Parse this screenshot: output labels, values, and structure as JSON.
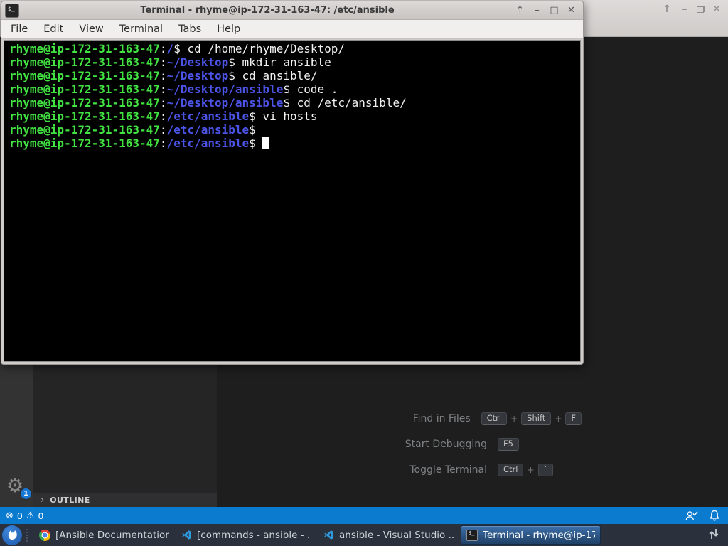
{
  "terminal_window": {
    "title": "Terminal - rhyme@ip-172-31-163-47: /etc/ansible",
    "menu": [
      "File",
      "Edit",
      "View",
      "Terminal",
      "Tabs",
      "Help"
    ],
    "user": "rhyme@ip-172-31-163-47",
    "prompt_separator": ":",
    "prompt_symbol": "$",
    "lines": [
      {
        "path": "/",
        "command": "cd /home/rhyme/Desktop/"
      },
      {
        "path": "~/Desktop",
        "command": "mkdir ansible"
      },
      {
        "path": "~/Desktop",
        "command": "cd ansible/"
      },
      {
        "path": "~/Desktop/ansible",
        "command": "code ."
      },
      {
        "path": "~/Desktop/ansible",
        "command": "cd /etc/ansible/"
      },
      {
        "path": "/etc/ansible",
        "command": "vi hosts"
      },
      {
        "path": "/etc/ansible",
        "command": ""
      },
      {
        "path": "/etc/ansible",
        "command": "",
        "cursor": true
      }
    ],
    "colors": {
      "user": "#42e242",
      "path": "#4c54e8",
      "text": "#f2f2f2",
      "background": "#000000"
    }
  },
  "vscode": {
    "shortcuts": [
      {
        "label": "Find in Files",
        "keys": [
          "Ctrl",
          "Shift",
          "F"
        ]
      },
      {
        "label": "Start Debugging",
        "keys": [
          "F5"
        ]
      },
      {
        "label": "Toggle Terminal",
        "keys": [
          "Ctrl",
          "`"
        ]
      }
    ],
    "outline": {
      "label": "OUTLINE",
      "chevron": "›"
    },
    "activity_bar": {
      "gear_badge": "1"
    },
    "status_bar": {
      "errors": "0",
      "warnings": "0",
      "color": "#0b7bd0"
    }
  },
  "taskbar": {
    "items": [
      {
        "icon": "chrome",
        "title": "[Ansible Documentation...",
        "active": false
      },
      {
        "icon": "vscode",
        "title": "[commands - ansible - ...",
        "active": false
      },
      {
        "icon": "vscode",
        "title": "ansible - Visual Studio ...",
        "active": false
      },
      {
        "icon": "terminal",
        "title": "Terminal - rhyme@ip-17...",
        "active": true
      }
    ],
    "active_color": "#35649c"
  }
}
